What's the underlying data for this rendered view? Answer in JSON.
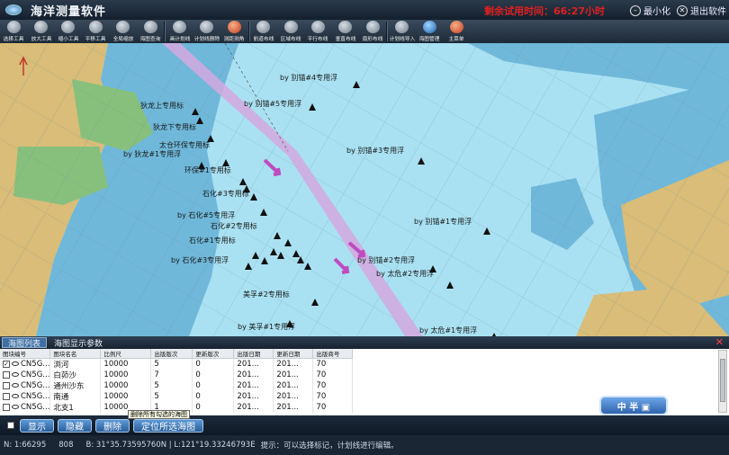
{
  "app": {
    "title": "海洋测量软件",
    "trial_notice": "剩余试用时间：66:27小时",
    "minimize_label": "最小化",
    "exit_label": "退出软件"
  },
  "toolbar": {
    "items": [
      {
        "label": "选择工具",
        "icon": "cursor-icon"
      },
      {
        "label": "放大工具",
        "icon": "zoom-in-icon"
      },
      {
        "label": "缩小工具",
        "icon": "zoom-out-icon"
      },
      {
        "label": "平移工具",
        "icon": "hand-icon"
      },
      {
        "label": "全局缩放",
        "icon": "fit-extent-icon"
      },
      {
        "label": "海图查询",
        "icon": "query-icon"
      },
      {
        "label": "画计划线",
        "icon": "draw-line-icon"
      },
      {
        "label": "计划线删除",
        "icon": "delete-line-icon"
      },
      {
        "label": "测距测角",
        "icon": "measure-icon"
      },
      {
        "label": "航道布线",
        "icon": "channel-icon"
      },
      {
        "label": "区域布线",
        "icon": "area-icon"
      },
      {
        "label": "平行布线",
        "icon": "parallel-icon"
      },
      {
        "label": "垂直布线",
        "icon": "perpendicular-icon"
      },
      {
        "label": "扇形布线",
        "icon": "sector-icon"
      },
      {
        "label": "计划线导入",
        "icon": "import-icon"
      },
      {
        "label": "海图管理",
        "icon": "globe-icon"
      },
      {
        "label": "主菜单",
        "icon": "menu-icon"
      }
    ]
  },
  "map": {
    "labels": [
      "by 别锚#4专用浮",
      "by 别锚#5专用浮",
      "狄龙上专用标",
      "狄龙下专用标",
      "太仓环保专用标",
      "by 狄龙#1专用浮",
      "环保#1专用标",
      "by 别锚#3专用浮",
      "石化#3专用标",
      "by 石化#5专用浮",
      "石化#2专用标",
      "by 别锚#1专用浮",
      "石化#1专用标",
      "by 石化#3专用浮",
      "by 别锚#2专用浮",
      "by 太危#2专用浮",
      "美孚#2专用标",
      "by 美孚#1专用浮",
      "by 太危#1专用浮"
    ],
    "colors": {
      "land": "#d9bd78",
      "deep_water": "#a9e1f2",
      "shallow_water": "#6fb8da",
      "channel": "#d4a8e0",
      "arrow": "#c04bbf"
    }
  },
  "panel": {
    "tabs": [
      "海图列表",
      "海图显示参数"
    ],
    "columns": [
      "图块编号",
      "图块名名",
      "比例尺",
      "出版版次",
      "更新版次",
      "出版日期",
      "更新日期",
      "出版商号"
    ],
    "rows": [
      {
        "checked": true,
        "id": "CN5G...",
        "name": "浏河",
        "scale": "10000",
        "edition": "5",
        "update": "0",
        "pub_date": "201...",
        "upd_date": "201...",
        "publisher": "70"
      },
      {
        "checked": false,
        "id": "CN5G...",
        "name": "白茆沙",
        "scale": "10000",
        "edition": "7",
        "update": "0",
        "pub_date": "201...",
        "upd_date": "201...",
        "publisher": "70"
      },
      {
        "checked": false,
        "id": "CN5G...",
        "name": "通州沙东",
        "scale": "10000",
        "edition": "5",
        "update": "0",
        "pub_date": "201...",
        "upd_date": "201...",
        "publisher": "70"
      },
      {
        "checked": false,
        "id": "CN5G...",
        "name": "南通",
        "scale": "10000",
        "edition": "5",
        "update": "0",
        "pub_date": "201...",
        "upd_date": "201...",
        "publisher": "70"
      },
      {
        "checked": false,
        "id": "CN5G...",
        "name": "北支1",
        "scale": "10000",
        "edition": "1",
        "update": "0",
        "pub_date": "201...",
        "upd_date": "201...",
        "publisher": "70"
      }
    ]
  },
  "bottom_buttons": [
    "显示",
    "隐藏",
    "删除",
    "定位所选海图"
  ],
  "tooltip": "删除所有勾选的海图",
  "zoom_badge": "中 半 ▣",
  "status": {
    "scale": "N: 1:66295",
    "counter": "808",
    "coords": "B: 31°35.73595760N | L:121°19.33246793E",
    "hint": "提示：可以选择标记，计划线进行编辑。"
  }
}
